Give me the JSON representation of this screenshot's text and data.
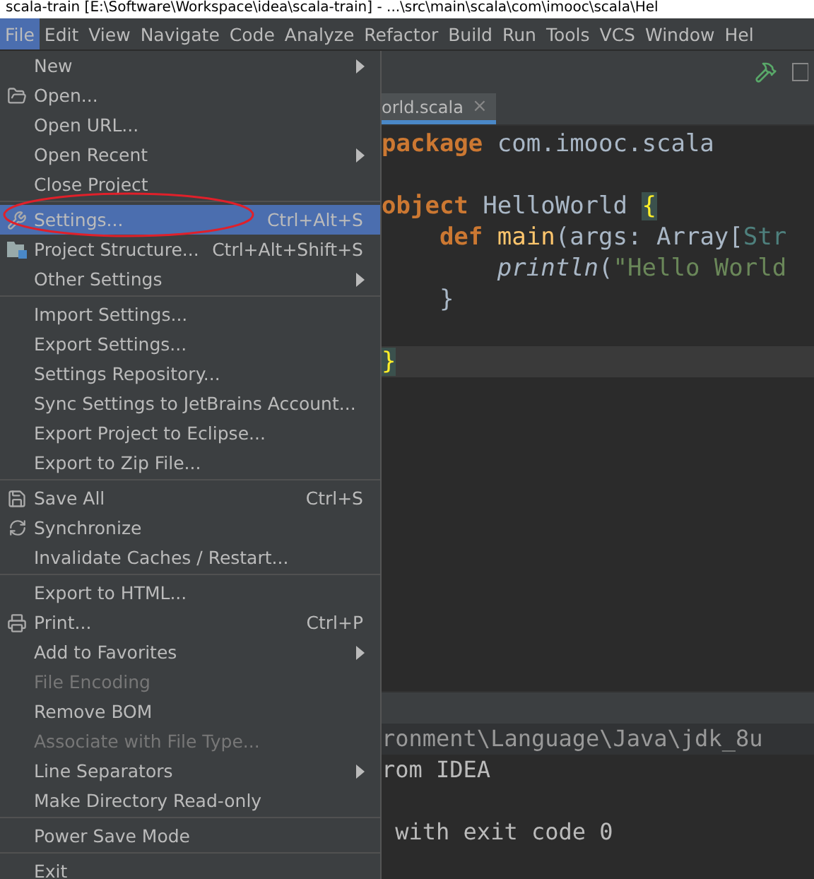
{
  "window": {
    "title": "scala-train [E:\\Software\\Workspace\\idea\\scala-train] - ...\\src\\main\\scala\\com\\imooc\\scala\\Hel"
  },
  "menubar": [
    {
      "label": "File",
      "selected": true
    },
    {
      "label": "Edit",
      "selected": false
    },
    {
      "label": "View",
      "selected": false
    },
    {
      "label": "Navigate",
      "selected": false
    },
    {
      "label": "Code",
      "selected": false
    },
    {
      "label": "Analyze",
      "selected": false
    },
    {
      "label": "Refactor",
      "selected": false
    },
    {
      "label": "Build",
      "selected": false
    },
    {
      "label": "Run",
      "selected": false
    },
    {
      "label": "Tools",
      "selected": false
    },
    {
      "label": "VCS",
      "selected": false
    },
    {
      "label": "Window",
      "selected": false
    },
    {
      "label": "Hel",
      "selected": false
    }
  ],
  "file_menu": [
    {
      "kind": "item",
      "label": "New",
      "submenu": true,
      "disabled": false,
      "selected": false
    },
    {
      "kind": "item",
      "label": "Open...",
      "disabled": false,
      "selected": false
    },
    {
      "kind": "item",
      "label": "Open URL...",
      "disabled": false,
      "selected": false
    },
    {
      "kind": "item",
      "label": "Open Recent",
      "submenu": true,
      "disabled": false,
      "selected": false
    },
    {
      "kind": "item",
      "label": "Close Project",
      "disabled": false,
      "selected": false
    },
    {
      "kind": "separator"
    },
    {
      "kind": "item",
      "label": "Settings...",
      "shortcut": "Ctrl+Alt+S",
      "disabled": false,
      "selected": true,
      "circled": true
    },
    {
      "kind": "item",
      "label": "Project Structure...",
      "shortcut": "Ctrl+Alt+Shift+S",
      "disabled": false,
      "selected": false
    },
    {
      "kind": "item",
      "label": "Other Settings",
      "submenu": true,
      "disabled": false,
      "selected": false
    },
    {
      "kind": "separator"
    },
    {
      "kind": "item",
      "label": "Import Settings...",
      "disabled": false,
      "selected": false
    },
    {
      "kind": "item",
      "label": "Export Settings...",
      "disabled": false,
      "selected": false
    },
    {
      "kind": "item",
      "label": "Settings Repository...",
      "disabled": false,
      "selected": false
    },
    {
      "kind": "item",
      "label": "Sync Settings to JetBrains Account...",
      "disabled": false,
      "selected": false
    },
    {
      "kind": "item",
      "label": "Export Project to Eclipse...",
      "disabled": false,
      "selected": false
    },
    {
      "kind": "item",
      "label": "Export to Zip File...",
      "disabled": false,
      "selected": false
    },
    {
      "kind": "separator"
    },
    {
      "kind": "item",
      "label": "Save All",
      "shortcut": "Ctrl+S",
      "disabled": false,
      "selected": false
    },
    {
      "kind": "item",
      "label": "Synchronize",
      "disabled": false,
      "selected": false
    },
    {
      "kind": "item",
      "label": "Invalidate Caches / Restart...",
      "disabled": false,
      "selected": false
    },
    {
      "kind": "separator"
    },
    {
      "kind": "item",
      "label": "Export to HTML...",
      "disabled": false,
      "selected": false
    },
    {
      "kind": "item",
      "label": "Print...",
      "shortcut": "Ctrl+P",
      "disabled": false,
      "selected": false
    },
    {
      "kind": "item",
      "label": "Add to Favorites",
      "submenu": true,
      "disabled": false,
      "selected": false
    },
    {
      "kind": "item",
      "label": "File Encoding",
      "disabled": true,
      "selected": false
    },
    {
      "kind": "item",
      "label": "Remove BOM",
      "disabled": false,
      "selected": false
    },
    {
      "kind": "item",
      "label": "Associate with File Type...",
      "disabled": true,
      "selected": false
    },
    {
      "kind": "item",
      "label": "Line Separators",
      "submenu": true,
      "disabled": false,
      "selected": false
    },
    {
      "kind": "item",
      "label": "Make Directory Read-only",
      "disabled": false,
      "selected": false
    },
    {
      "kind": "separator"
    },
    {
      "kind": "item",
      "label": "Power Save Mode",
      "disabled": false,
      "selected": false
    },
    {
      "kind": "separator"
    },
    {
      "kind": "item",
      "label": "Exit",
      "disabled": false,
      "selected": false
    }
  ],
  "editor_tab": {
    "label": "orld.scala",
    "close": "×"
  },
  "code_lines": [
    {
      "kind": "code",
      "current": false,
      "tokens": [
        {
          "kind": "keyword",
          "text": "package"
        },
        {
          "kind": "plain",
          "text": " com.imooc.scala"
        }
      ]
    },
    {
      "kind": "blank"
    },
    {
      "kind": "code",
      "current": false,
      "tokens": [
        {
          "kind": "keyword",
          "text": "object"
        },
        {
          "kind": "plain",
          "text": " HelloWorld "
        },
        {
          "kind": "brace",
          "text": "{"
        }
      ]
    },
    {
      "kind": "code",
      "current": false,
      "tokens": [
        {
          "kind": "keyword",
          "text": "    def"
        },
        {
          "kind": "function",
          "text": " main"
        },
        {
          "kind": "plain",
          "text": "(args: Array["
        },
        {
          "kind": "type",
          "text": "Str"
        }
      ]
    },
    {
      "kind": "code",
      "current": false,
      "tokens": [
        {
          "kind": "italic",
          "text": "        println"
        },
        {
          "kind": "plain",
          "text": "("
        },
        {
          "kind": "string",
          "text": "\"Hello World"
        }
      ]
    },
    {
      "kind": "code",
      "current": false,
      "tokens": [
        {
          "kind": "plain",
          "text": "    }"
        }
      ]
    },
    {
      "kind": "blank"
    },
    {
      "kind": "code",
      "current": true,
      "tokens": [
        {
          "kind": "brace",
          "text": "}"
        }
      ]
    }
  ],
  "run_output": [
    {
      "text": "ronment\\Language\\Java\\jdk_8u",
      "kind": "command"
    },
    {
      "text": "rom IDEA",
      "kind": "plain"
    },
    {
      "kind": "blank"
    },
    {
      "text": " with exit code 0",
      "kind": "plain"
    }
  ]
}
